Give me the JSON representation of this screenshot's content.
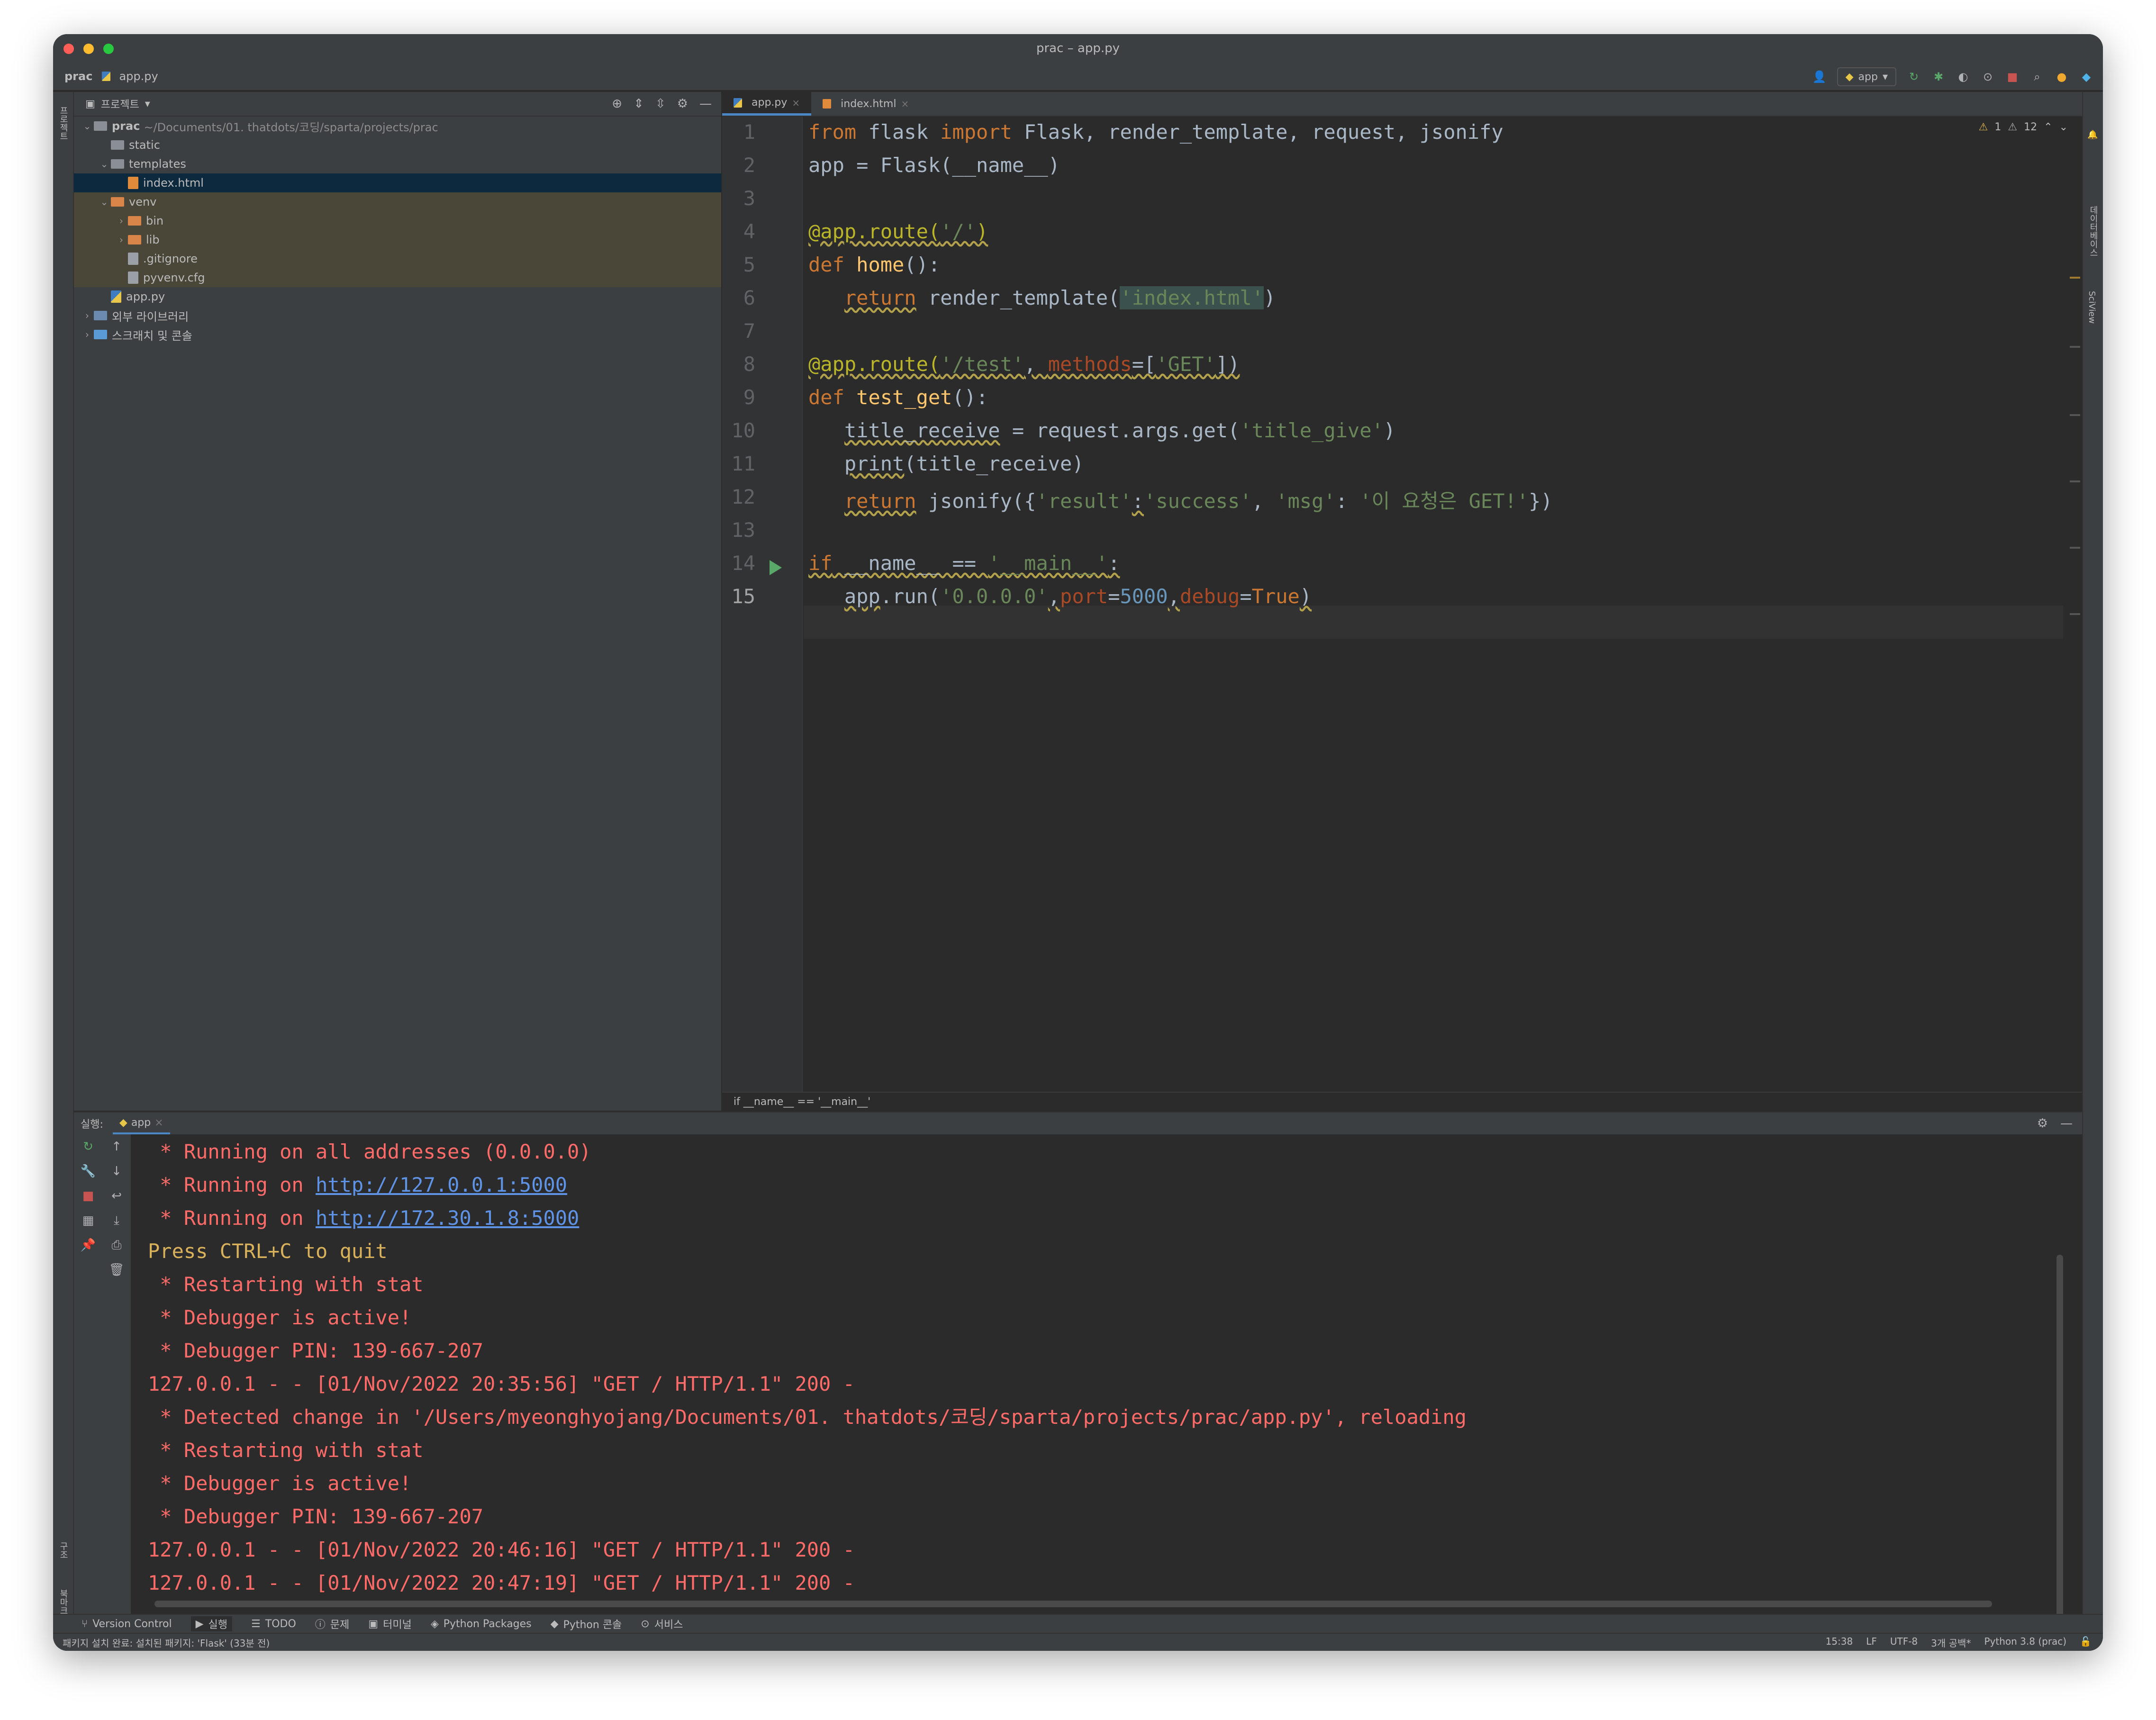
{
  "window": {
    "title": "prac – app.py"
  },
  "navbar": {
    "project": "prac",
    "file": "app.py",
    "run_config": "app"
  },
  "project_panel": {
    "title": "프로젝트",
    "tree": [
      {
        "label": "prac",
        "path": "~/Documents/01. thatdots/코딩/sparta/projects/prac",
        "type": "folder",
        "depth": 0,
        "expanded": true
      },
      {
        "label": "static",
        "type": "folder",
        "depth": 1
      },
      {
        "label": "templates",
        "type": "folder",
        "depth": 1,
        "expanded": true
      },
      {
        "label": "index.html",
        "type": "html",
        "depth": 2,
        "selected": true
      },
      {
        "label": "venv",
        "type": "folder-orange",
        "depth": 1,
        "expanded": true,
        "venv": true
      },
      {
        "label": "bin",
        "type": "folder-orange",
        "depth": 2,
        "venv": true,
        "collapsed": true
      },
      {
        "label": "lib",
        "type": "folder-orange",
        "depth": 2,
        "venv": true,
        "collapsed": true
      },
      {
        "label": ".gitignore",
        "type": "txt",
        "depth": 2,
        "venv": true
      },
      {
        "label": "pyvenv.cfg",
        "type": "txt",
        "depth": 2,
        "venv": true
      },
      {
        "label": "app.py",
        "type": "py",
        "depth": 1
      },
      {
        "label": "외부 라이브러리",
        "type": "lib",
        "depth": 0,
        "collapsed": true
      },
      {
        "label": "스크래치 및 콘솔",
        "type": "scratch",
        "depth": 0,
        "collapsed": true
      }
    ]
  },
  "editor": {
    "tabs": [
      {
        "label": "app.py",
        "active": true
      },
      {
        "label": "index.html",
        "active": false
      }
    ],
    "warnings": {
      "warn": "1",
      "weak": "12"
    },
    "breadcrumb": "if __name__ == '__main__'",
    "lines": [
      {
        "n": "1",
        "html": "<span class='kw'>from</span> flask <span class='kw'>import</span> Flask, render_template, request, jsonify"
      },
      {
        "n": "2",
        "html": "app = Flask(__name__)"
      },
      {
        "n": "3",
        "html": ""
      },
      {
        "n": "4",
        "html": "<span class='dec wav'>@app.route(</span><span class='str wav'>'/'</span><span class='dec wav'>)</span>"
      },
      {
        "n": "5",
        "html": "<span class='kw'>def</span> <span class='fn'>home</span>():"
      },
      {
        "n": "6",
        "html": "   <span class='kw wav'>return</span> render_template(<span class='str strhl'>'index.html'</span>)"
      },
      {
        "n": "7",
        "html": ""
      },
      {
        "n": "8",
        "html": "<span class='dec wav'>@app.route(</span><span class='str wav'>'/test'</span><span class='wav'>, </span><span class='pm wav'>methods</span><span class='wav'>=[</span><span class='str wav'>'GET'</span><span class='wav'>])</span>"
      },
      {
        "n": "9",
        "html": "<span class='kw'>def</span> <span class='fn'>test_get</span>():"
      },
      {
        "n": "10",
        "html": "   <span class='wav'>title_receive</span> = request.args.get(<span class='str'>'title_give'</span>)"
      },
      {
        "n": "11",
        "html": "   <span class='wav'>print</span>(title_receive)"
      },
      {
        "n": "12",
        "html": "   <span class='kw wav'>return</span> jsonify({<span class='str'>'result'</span><span class='wav'>:</span><span class='str'>'success'</span>, <span class='str'>'msg'</span>: <span class='str'>'이 요청은 GET!'</span>})"
      },
      {
        "n": "13",
        "html": ""
      },
      {
        "n": "14",
        "html": "<span class='kw wav'>if</span><span class='wav'> __name__ == </span><span class='str wav'>'__main__'</span><span class='wav'>:</span>"
      },
      {
        "n": "15",
        "html": "   <span class='wav'>app</span>.run(<span class='str'>'0.0.0.0'</span><span class='wav'>,</span><span class='pm'>port</span>=<span class='num'>5000</span><span class='wav'>,</span><span class='pm'>debug</span>=<span class='kw'>True</span><span class='wav'>)</span>"
      }
    ]
  },
  "run_panel": {
    "label": "실행:",
    "tab": "app",
    "lines": [
      {
        "text": " * Running on all addresses (0.0.0.0)"
      },
      {
        "text": " * Running on ",
        "link": "http://127.0.0.1:5000"
      },
      {
        "text": " * Running on ",
        "link": "http://172.30.1.8:5000"
      },
      {
        "text": "Press CTRL+C to quit",
        "warn": true
      },
      {
        "text": " * Restarting with stat"
      },
      {
        "text": " * Debugger is active!"
      },
      {
        "text": " * Debugger PIN: 139-667-207"
      },
      {
        "text": "127.0.0.1 - - [01/Nov/2022 20:35:56] \"GET / HTTP/1.1\" 200 -"
      },
      {
        "text": " * Detected change in '/Users/myeonghyojang/Documents/01. thatdots/코딩/sparta/projects/prac/app.py', reloading"
      },
      {
        "text": " * Restarting with stat"
      },
      {
        "text": " * Debugger is active!"
      },
      {
        "text": " * Debugger PIN: 139-667-207"
      },
      {
        "text": "127.0.0.1 - - [01/Nov/2022 20:46:16] \"GET / HTTP/1.1\" 200 -"
      },
      {
        "text": "127.0.0.1 - - [01/Nov/2022 20:47:19] \"GET / HTTP/1.1\" 200 -"
      }
    ]
  },
  "tool_windows": [
    "Version Control",
    "실행",
    "TODO",
    "문제",
    "터미널",
    "Python Packages",
    "Python 콘솔",
    "서비스"
  ],
  "statusbar": {
    "message": "패키지 설치 완료: 설치된 패키지: 'Flask' (33분 전)",
    "time": "15:38",
    "eol": "LF",
    "encoding": "UTF-8",
    "indent": "3개 공백*",
    "interpreter": "Python 3.8 (prac)"
  },
  "side_labels": {
    "left_top": "프로젝트",
    "right_db": "데이터베이스",
    "right_sci": "SciView",
    "left_bottom_1": "구조",
    "left_bottom_2": "북마크"
  }
}
